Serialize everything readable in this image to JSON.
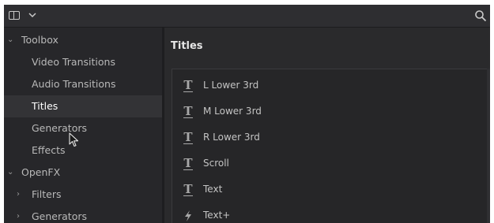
{
  "toolbar": {
    "panel_toggle_icon": "sidebar-panel-icon",
    "dropdown_icon": "chevron-down-icon",
    "search_icon": "search-icon"
  },
  "sidebar": {
    "items": [
      {
        "label": "Toolbox",
        "expanded": true,
        "level": 0
      },
      {
        "label": "Video Transitions",
        "level": 1
      },
      {
        "label": "Audio Transitions",
        "level": 1
      },
      {
        "label": "Titles",
        "level": 1,
        "selected": true
      },
      {
        "label": "Generators",
        "level": 1
      },
      {
        "label": "Effects",
        "level": 1
      },
      {
        "label": "OpenFX",
        "expanded": true,
        "level": 0
      },
      {
        "label": "Filters",
        "expanded": false,
        "level": 1
      },
      {
        "label": "Generators",
        "expanded": false,
        "level": 1
      }
    ]
  },
  "content": {
    "title": "Titles",
    "items": [
      {
        "label": "L Lower 3rd",
        "icon": "text-title-icon"
      },
      {
        "label": "M Lower 3rd",
        "icon": "text-title-icon"
      },
      {
        "label": "R Lower 3rd",
        "icon": "text-title-icon"
      },
      {
        "label": "Scroll",
        "icon": "text-title-icon"
      },
      {
        "label": "Text",
        "icon": "text-title-icon"
      },
      {
        "label": "Text+",
        "icon": "fusion-lightning-icon"
      }
    ]
  },
  "colors": {
    "background": "#2a2a2c",
    "sidebar": "#27272a",
    "selected_row": "#333336",
    "text": "#c4c4c4"
  }
}
